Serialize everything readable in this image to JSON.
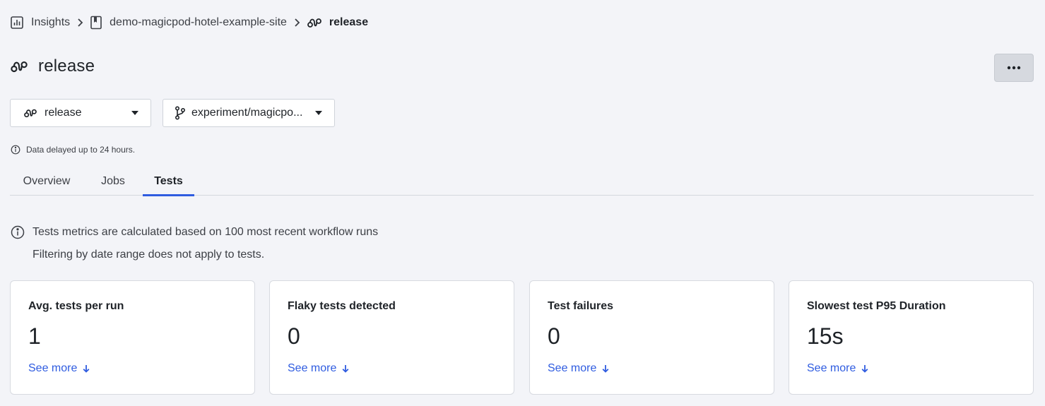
{
  "breadcrumb": {
    "items": [
      {
        "label": "Insights",
        "icon": "chart-icon"
      },
      {
        "label": "demo-magicpod-hotel-example-site",
        "icon": "repo-icon"
      },
      {
        "label": "release",
        "icon": "workflow-icon"
      }
    ]
  },
  "header": {
    "title": "release",
    "title_icon": "workflow-icon",
    "more_button_icon": "ellipsis-icon"
  },
  "filters": {
    "workflow": {
      "value": "release",
      "icon": "workflow-icon"
    },
    "branch": {
      "value": "experiment/magicpo...",
      "icon": "branch-icon"
    }
  },
  "notice": {
    "delay": "Data delayed up to 24 hours."
  },
  "tabs": [
    {
      "label": "Overview",
      "active": false
    },
    {
      "label": "Jobs",
      "active": false
    },
    {
      "label": "Tests",
      "active": true
    }
  ],
  "tests_info": {
    "line1": "Tests metrics are calculated based on 100 most recent workflow runs",
    "line2": "Filtering by date range does not apply to tests."
  },
  "cards": [
    {
      "title": "Avg. tests per run",
      "value": "1",
      "link": "See more"
    },
    {
      "title": "Flaky tests detected",
      "value": "0",
      "link": "See more"
    },
    {
      "title": "Test failures",
      "value": "0",
      "link": "See more"
    },
    {
      "title": "Slowest test P95 Duration",
      "value": "15s",
      "link": "See more"
    }
  ],
  "colors": {
    "accent": "#2f5ce0",
    "background": "#f3f4f8",
    "card": "#ffffff"
  }
}
